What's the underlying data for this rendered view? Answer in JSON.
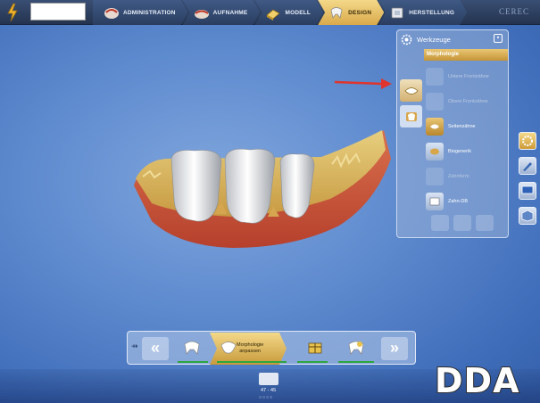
{
  "topbar": {
    "steps": [
      {
        "label": "ADMINISTRATION",
        "active": false
      },
      {
        "label": "AUFNAHME",
        "active": false
      },
      {
        "label": "MODELL",
        "active": false
      },
      {
        "label": "DESIGN",
        "active": true
      },
      {
        "label": "HERSTELLUNG",
        "active": false
      }
    ],
    "brand": "CEREC"
  },
  "tools_panel": {
    "title": "Werkzeuge",
    "section": "Morphologie",
    "tools": [
      {
        "label": "Untere Frontzähne",
        "state": "disabled"
      },
      {
        "label": "Obere Frontzähne",
        "state": "disabled"
      },
      {
        "label": "Seitenzähne",
        "state": "active"
      },
      {
        "label": "Biogenerik",
        "state": "normal"
      },
      {
        "label": "Zahnform",
        "state": "disabled"
      },
      {
        "label": "Zahn-DB",
        "state": "normal"
      }
    ]
  },
  "bottom_bar": {
    "active_step_line1": "Morphologie",
    "active_step_line2": "anpassen"
  },
  "status": {
    "tooth_range": "47 - 45",
    "watermark": "DDA"
  },
  "colors": {
    "accent_gold": "#d9a94a",
    "background_blue": "#5f8bcf",
    "progress_green": "#2ea640",
    "arrow_red": "#e0342c"
  }
}
